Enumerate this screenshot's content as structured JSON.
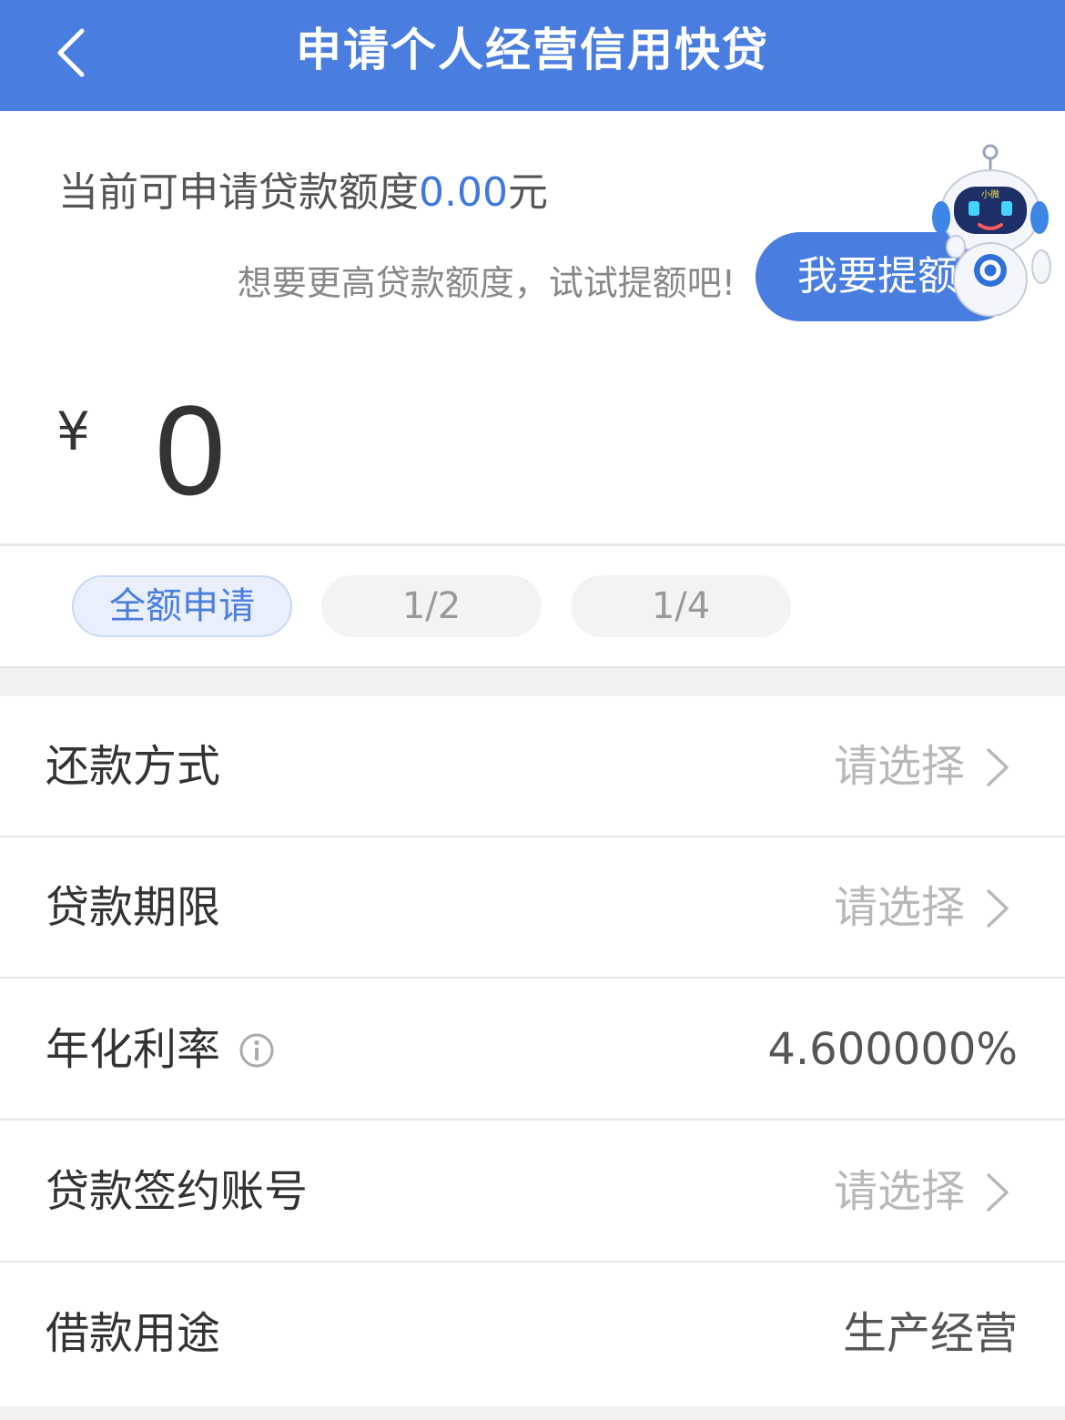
{
  "header": {
    "title": "申请个人经营信用快贷",
    "back_icon": "chevron-left-icon"
  },
  "quota": {
    "label": "当前可申请贷款额度",
    "amount": "0.00",
    "unit": "元",
    "hint": "想要更高贷款额度，试试提额吧!",
    "raise_button": "我要提额",
    "mascot_badge": "小微"
  },
  "amount_input": {
    "currency": "¥",
    "value": "0"
  },
  "ratio_options": [
    {
      "label": "全额申请",
      "selected": true
    },
    {
      "label": "1/2",
      "selected": false
    },
    {
      "label": "1/4",
      "selected": false
    }
  ],
  "form": {
    "repayment_method": {
      "label": "还款方式",
      "value": "请选择"
    },
    "loan_term": {
      "label": "贷款期限",
      "value": "请选择"
    },
    "annual_rate": {
      "label": "年化利率",
      "value": "4.600000%",
      "icon": "info-icon"
    },
    "signing_account": {
      "label": "贷款签约账号",
      "value": "请选择"
    },
    "loan_purpose": {
      "label": "借款用途",
      "value": "生产经营"
    }
  },
  "colors": {
    "brand_blue": "#4a7de0",
    "accent_text": "#3f78e0",
    "placeholder": "#b8b8b8"
  }
}
